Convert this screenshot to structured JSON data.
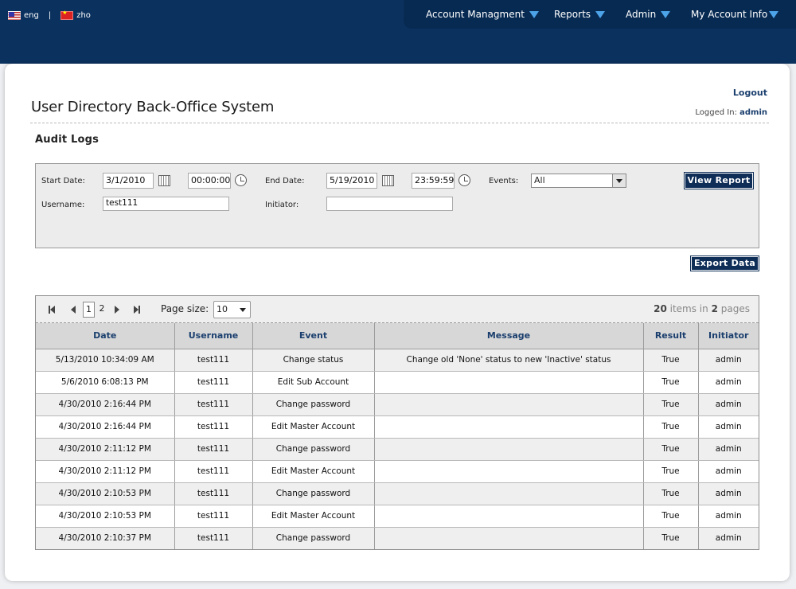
{
  "lang": {
    "eng": "eng",
    "zho": "zho",
    "separator": "|"
  },
  "nav": [
    {
      "label": "Account Managment"
    },
    {
      "label": "Reports"
    },
    {
      "label": "Admin"
    },
    {
      "label": "My Account Info"
    }
  ],
  "header": {
    "title": "User Directory Back-Office System",
    "logout": "Logout",
    "logged_in_label": "Logged In:",
    "user": "admin"
  },
  "section_title": "Audit Logs",
  "filters": {
    "start_date_label": "Start Date:",
    "start_date": "3/1/2010",
    "start_time": "00:00:00",
    "end_date_label": "End Date:",
    "end_date": "5/19/2010",
    "end_time": "23:59:59",
    "events_label": "Events:",
    "events_value": "All",
    "username_label": "Username:",
    "username": "test111",
    "initiator_label": "Initiator:",
    "initiator": ""
  },
  "buttons": {
    "view_report": "View Report",
    "export_data": "Export Data"
  },
  "pager": {
    "current_page": "1",
    "page_2": "2",
    "page_size_label": "Page size:",
    "page_size": "10",
    "items_count": "20",
    "items_text": "items in",
    "pages_count": "2",
    "pages_text": "pages"
  },
  "table": {
    "columns": [
      "Date",
      "Username",
      "Event",
      "Message",
      "Result",
      "Initiator"
    ],
    "rows": [
      [
        "5/13/2010 10:34:09 AM",
        "test111",
        "Change status",
        "Change old 'None' status to new 'Inactive' status",
        "True",
        "admin"
      ],
      [
        "5/6/2010 6:08:13 PM",
        "test111",
        "Edit Sub Account",
        "",
        "True",
        "admin"
      ],
      [
        "4/30/2010 2:16:44 PM",
        "test111",
        "Change password",
        "",
        "True",
        "admin"
      ],
      [
        "4/30/2010 2:16:44 PM",
        "test111",
        "Edit Master Account",
        "",
        "True",
        "admin"
      ],
      [
        "4/30/2010 2:11:12 PM",
        "test111",
        "Change password",
        "",
        "True",
        "admin"
      ],
      [
        "4/30/2010 2:11:12 PM",
        "test111",
        "Edit Master Account",
        "",
        "True",
        "admin"
      ],
      [
        "4/30/2010 2:10:53 PM",
        "test111",
        "Change password",
        "",
        "True",
        "admin"
      ],
      [
        "4/30/2010 2:10:53 PM",
        "test111",
        "Edit Master Account",
        "",
        "True",
        "admin"
      ],
      [
        "4/30/2010 2:10:37 PM",
        "test111",
        "Change password",
        "",
        "True",
        "admin"
      ]
    ]
  }
}
